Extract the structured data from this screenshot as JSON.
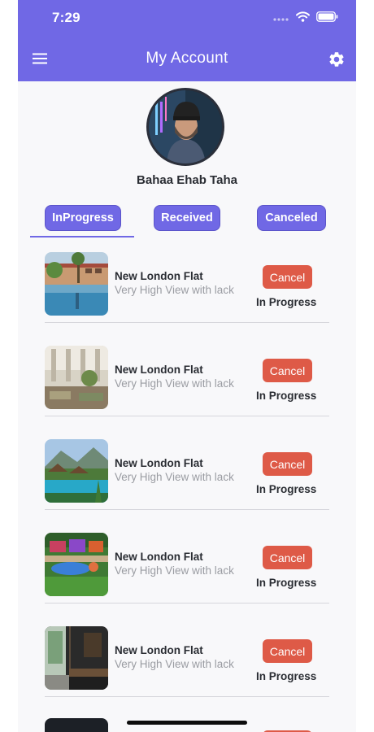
{
  "status_bar": {
    "time": "7:29",
    "icons": [
      "signal-icon",
      "wifi-icon",
      "battery-icon"
    ]
  },
  "app_bar": {
    "title": "My Account",
    "left_icon": "menu-icon",
    "right_icon": "settings-icon"
  },
  "profile": {
    "name": "Bahaa Ehab Taha"
  },
  "tabs": [
    {
      "label": "InProgress",
      "selected": true
    },
    {
      "label": "Received",
      "selected": false
    },
    {
      "label": "Canceled",
      "selected": false
    }
  ],
  "bookings": [
    {
      "title": "New London Flat",
      "subtitle": "Very High View with lack",
      "action": "Cancel",
      "status": "In Progress"
    },
    {
      "title": "New London Flat",
      "subtitle": "Very High View with lack",
      "action": "Cancel",
      "status": "In Progress"
    },
    {
      "title": "New London Flat",
      "subtitle": "Very High View with lack",
      "action": "Cancel",
      "status": "In Progress"
    },
    {
      "title": "New London Flat",
      "subtitle": "Very High View with lack",
      "action": "Cancel",
      "status": "In Progress"
    },
    {
      "title": "New London Flat",
      "subtitle": "Very High View with lack",
      "action": "Cancel",
      "status": "In Progress"
    }
  ],
  "colors": {
    "primary": "#7068e5",
    "cancel": "#de5a47",
    "background": "#f8f8fa"
  }
}
